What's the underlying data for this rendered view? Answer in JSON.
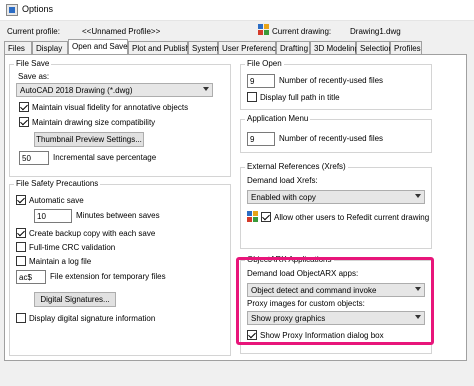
{
  "window": {
    "title": "Options"
  },
  "header": {
    "profile_label": "Current profile:",
    "profile_value": "<<Unnamed Profile>>",
    "drawing_label": "Current drawing:",
    "drawing_value": "Drawing1.dwg"
  },
  "tabs": [
    "Files",
    "Display",
    "Open and Save",
    "Plot and Publish",
    "System",
    "User Preferences",
    "Drafting",
    "3D Modeling",
    "Selection",
    "Profiles"
  ],
  "active_tab": "Open and Save",
  "file_save": {
    "title": "File Save",
    "save_as_label": "Save as:",
    "save_as_value": "AutoCAD 2018 Drawing (*.dwg)",
    "fidelity_label": "Maintain visual fidelity for annotative objects",
    "fidelity_checked": true,
    "drawing_size_label": "Maintain drawing size compatibility",
    "drawing_size_checked": true,
    "thumbnail_button": "Thumbnail Preview Settings...",
    "incremental_value": "50",
    "incremental_label": "Incremental save percentage"
  },
  "file_safety": {
    "title": "File Safety Precautions",
    "autosave_label": "Automatic save",
    "autosave_checked": true,
    "minutes_value": "10",
    "minutes_label": "Minutes between saves",
    "backup_label": "Create backup copy with each save",
    "backup_checked": true,
    "crc_label": "Full-time CRC validation",
    "crc_checked": false,
    "logfile_label": "Maintain a log file",
    "logfile_checked": false,
    "temp_ext_value": "ac$",
    "temp_ext_label": "File extension for temporary files",
    "digsig_button": "Digital Signatures...",
    "digsig_info_label": "Display digital signature information",
    "digsig_info_checked": false
  },
  "file_open": {
    "title": "File Open",
    "recent_value": "9",
    "recent_label": "Number of recently-used files",
    "fullpath_label": "Display full path in title",
    "fullpath_checked": false
  },
  "app_menu": {
    "title": "Application Menu",
    "recent_value": "9",
    "recent_label": "Number of recently-used files"
  },
  "xrefs": {
    "title": "External References (Xrefs)",
    "demand_label": "Demand load Xrefs:",
    "demand_value": "Enabled with copy",
    "allow_label": "Allow other users to Refedit current drawing",
    "allow_checked": true
  },
  "objectarx": {
    "title": "ObjectARX Applications",
    "demand_label": "Demand load ObjectARX apps:",
    "demand_value": "Object detect and command invoke",
    "proxy_label": "Proxy images for custom objects:",
    "proxy_value": "Show proxy graphics",
    "show_proxy_label": "Show Proxy Information dialog box",
    "show_proxy_checked": true
  },
  "colors": {
    "highlight": "#e8157a",
    "accent": "#2b6cc4"
  }
}
